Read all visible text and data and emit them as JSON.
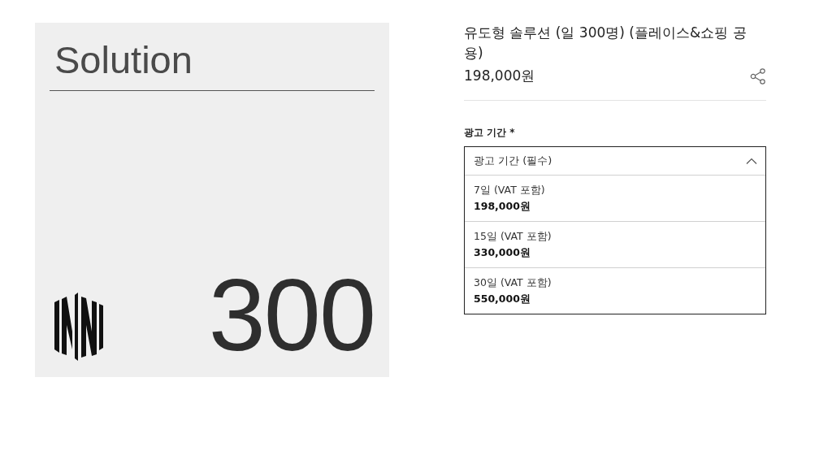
{
  "product_image": {
    "heading": "Solution",
    "number": "300"
  },
  "product": {
    "title": "유도형 솔루션 (일 300명) (플레이스&쇼핑 공용)",
    "price": "198,000원"
  },
  "option_field": {
    "label": "광고 기간 *",
    "placeholder": "광고 기간 (필수)",
    "expanded": true,
    "options": [
      {
        "name": "7일 (VAT 포함)",
        "price": "198,000원"
      },
      {
        "name": "15일 (VAT 포함)",
        "price": "330,000원"
      },
      {
        "name": "30일 (VAT 포함)",
        "price": "550,000원"
      }
    ]
  }
}
